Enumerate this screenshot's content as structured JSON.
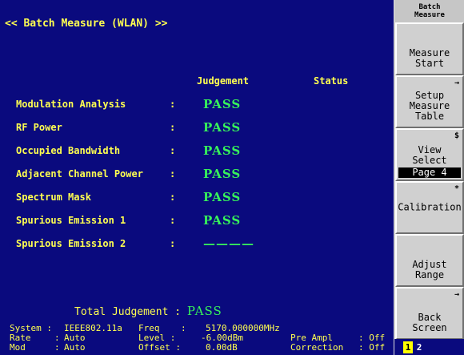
{
  "screen": {
    "title": "<< Batch Measure (WLAN) >>",
    "columns": {
      "judgement": "Judgement",
      "status": "Status"
    },
    "rows": [
      {
        "name": "Modulation Analysis",
        "colon": ":",
        "result": "PASS",
        "status": ""
      },
      {
        "name": "RF Power",
        "colon": ":",
        "result": "PASS",
        "status": ""
      },
      {
        "name": "Occupied Bandwidth",
        "colon": ":",
        "result": "PASS",
        "status": ""
      },
      {
        "name": "Adjacent Channel Power",
        "colon": ":",
        "result": "PASS",
        "status": ""
      },
      {
        "name": "Spectrum Mask",
        "colon": ":",
        "result": "PASS",
        "status": ""
      },
      {
        "name": "Spurious Emission 1",
        "colon": ":",
        "result": "PASS",
        "status": ""
      },
      {
        "name": "Spurious Emission 2",
        "colon": ":",
        "result": "————",
        "status": ""
      }
    ],
    "total": {
      "label": "Total Judgement :",
      "value": "PASS"
    }
  },
  "info": {
    "system": {
      "label": "System :",
      "value": "IEEE802.11a"
    },
    "rate": {
      "label": "Rate",
      "sep": ":",
      "value": "Auto"
    },
    "mod": {
      "label": "Mod",
      "sep": ":",
      "value": "Auto"
    },
    "freq": {
      "label": "Freq",
      "sep": ":",
      "value": "5170.000000MHz"
    },
    "level": {
      "label": "Level :",
      "value": "-6.00dBm"
    },
    "offset": {
      "label": "Offset :",
      "value": "0.00dB"
    },
    "pre_ampl": {
      "label": "Pre Ampl",
      "value": ": Off"
    },
    "correction": {
      "label": "Correction",
      "value": ": Off"
    }
  },
  "softkeys": {
    "title_line1": "Batch",
    "title_line2": "Measure",
    "keys": [
      {
        "line1": "Measure",
        "line2": "Start",
        "line3": "",
        "mark": ""
      },
      {
        "line1": "Setup",
        "line2": "Measure",
        "line3": "Table",
        "mark": "→"
      },
      {
        "line1": "View",
        "line2": "Select",
        "line3": "",
        "sub": "Page 4",
        "mark": "$"
      },
      {
        "line1": "Calibration",
        "line2": "",
        "line3": "",
        "mark": "*"
      },
      {
        "line1": "Adjust",
        "line2": "Range",
        "line3": "",
        "mark": ""
      },
      {
        "line1": "Back",
        "line2": "Screen",
        "line3": "",
        "mark": "→"
      }
    ],
    "page_indicator": {
      "p1": "1",
      "p2": "2"
    }
  }
}
